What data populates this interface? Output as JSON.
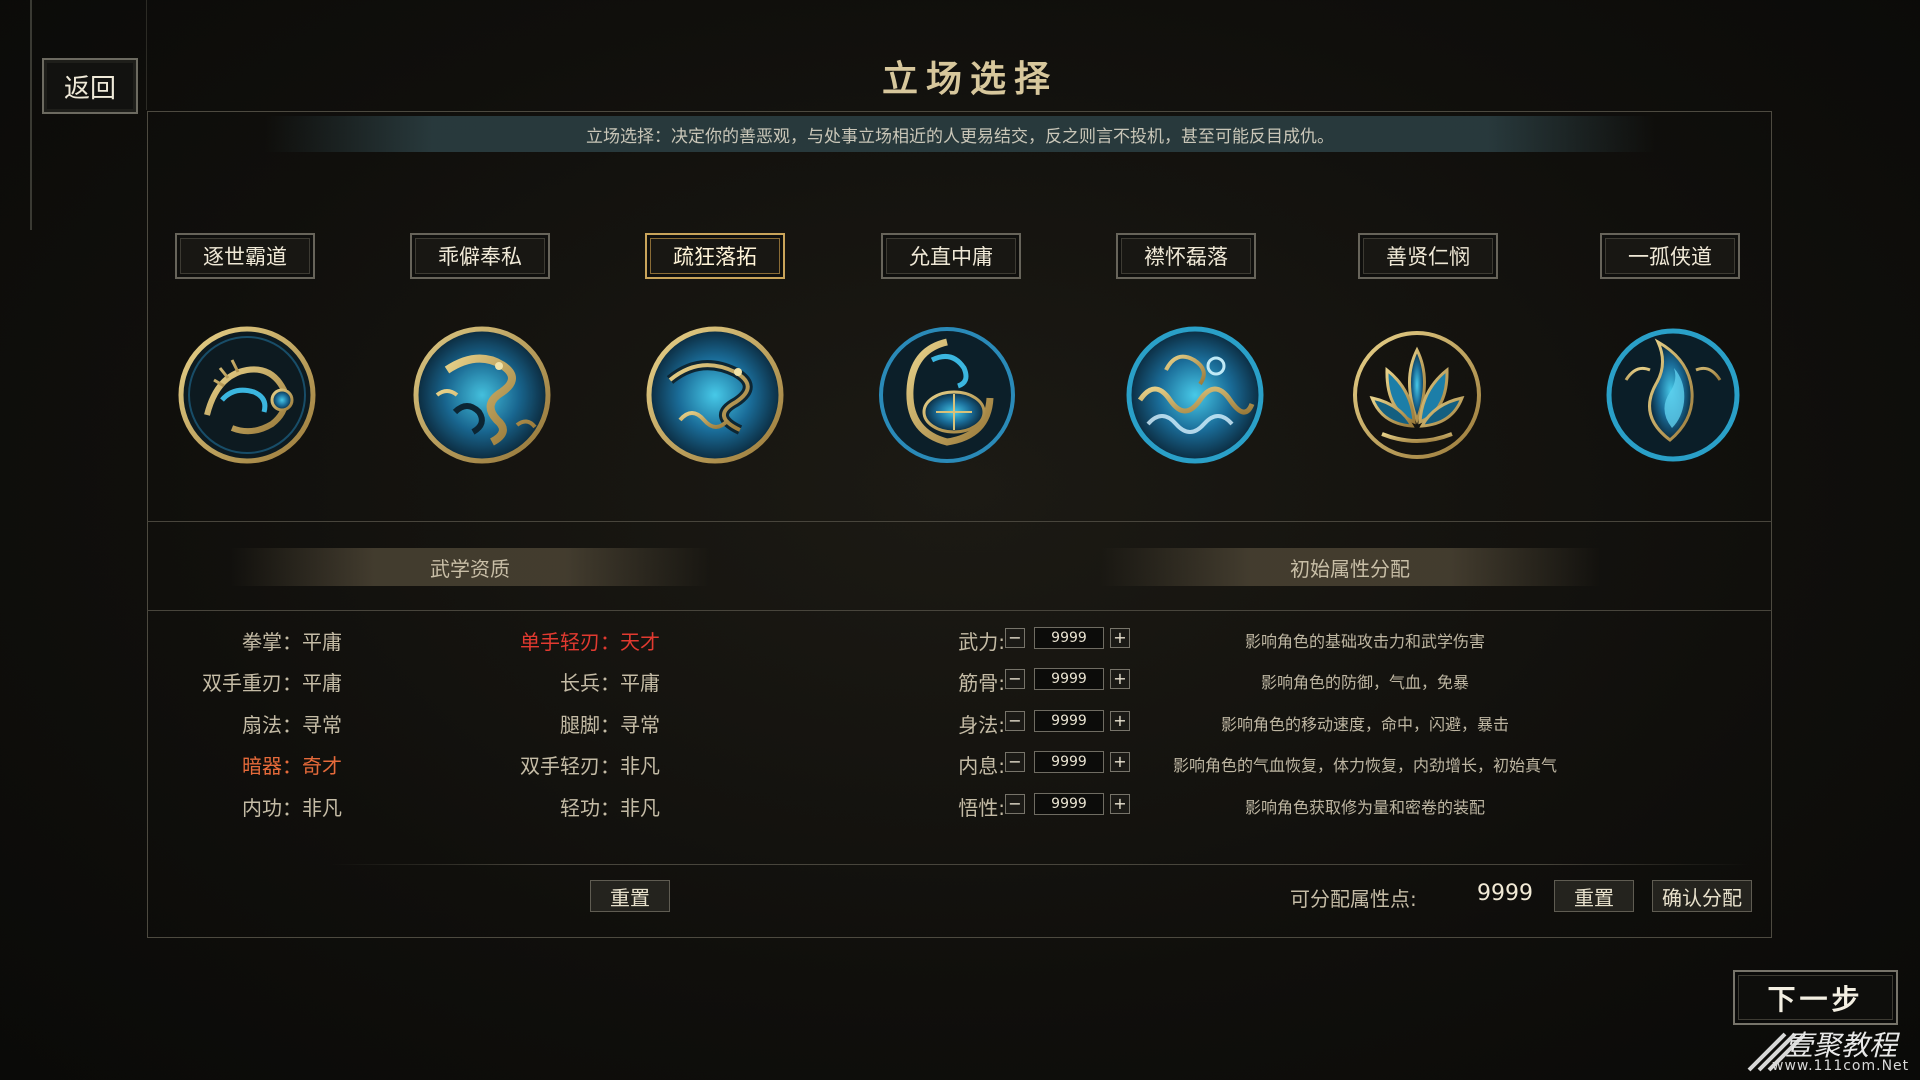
{
  "back_button": "返回",
  "title": "立场选择",
  "description": "立场选择：决定你的善恶观，与处事立场相近的人更易结交，反之则言不投机，甚至可能反目成仇。",
  "stances": [
    {
      "label": "逐世霸道",
      "emblem": "tiger-emblem-icon",
      "selected": false
    },
    {
      "label": "乖僻奉私",
      "emblem": "dragon-emblem-icon",
      "selected": false
    },
    {
      "label": "疏狂落拓",
      "emblem": "serpent-dragon-emblem-icon",
      "selected": true
    },
    {
      "label": "允直中庸",
      "emblem": "turtle-snake-emblem-icon",
      "selected": false
    },
    {
      "label": "襟怀磊落",
      "emblem": "wave-emblem-icon",
      "selected": false
    },
    {
      "label": "善贤仁悯",
      "emblem": "lotus-emblem-icon",
      "selected": false
    },
    {
      "label": "一孤侠道",
      "emblem": "phoenix-flame-emblem-icon",
      "selected": false
    }
  ],
  "martial_section": {
    "title": "武学资质",
    "skills": [
      {
        "name": "拳掌：",
        "value": "平庸",
        "color": "normal"
      },
      {
        "name": "单手轻刃：",
        "value": "天才",
        "color": "#e23a30"
      },
      {
        "name": "双手重刃：",
        "value": "平庸",
        "color": "normal"
      },
      {
        "name": "长兵：",
        "value": "平庸",
        "color": "normal"
      },
      {
        "name": "扇法：",
        "value": "寻常",
        "color": "normal"
      },
      {
        "name": "腿脚：",
        "value": "寻常",
        "color": "normal"
      },
      {
        "name": "暗器：",
        "value": "奇才",
        "color": "#e66a3a"
      },
      {
        "name": "双手轻刃：",
        "value": "非凡",
        "color": "normal"
      },
      {
        "name": "内功：",
        "value": "非凡",
        "color": "normal"
      },
      {
        "name": "轻功：",
        "value": "非凡",
        "color": "normal"
      }
    ],
    "reset_label": "重置"
  },
  "attribute_section": {
    "title": "初始属性分配",
    "attributes": [
      {
        "label": "武力:",
        "value": "9999",
        "desc": "影响角色的基础攻击力和武学伤害"
      },
      {
        "label": "筋骨:",
        "value": "9999",
        "desc": "影响角色的防御，气血，免暴"
      },
      {
        "label": "身法:",
        "value": "9999",
        "desc": "影响角色的移动速度，命中，闪避，暴击"
      },
      {
        "label": "内息:",
        "value": "9999",
        "desc": "影响角色的气血恢复，体力恢复，内劲增长，初始真气"
      },
      {
        "label": "悟性:",
        "value": "9999",
        "desc": "影响角色获取修为量和密卷的装配"
      }
    ],
    "minus": "−",
    "plus": "+",
    "points_label": "可分配属性点:",
    "points_value": "9999",
    "reset_label": "重置",
    "confirm_label": "确认分配"
  },
  "next_button": "下一步",
  "watermark": {
    "text": "壹聚教程",
    "url": "www.111com.Net"
  }
}
